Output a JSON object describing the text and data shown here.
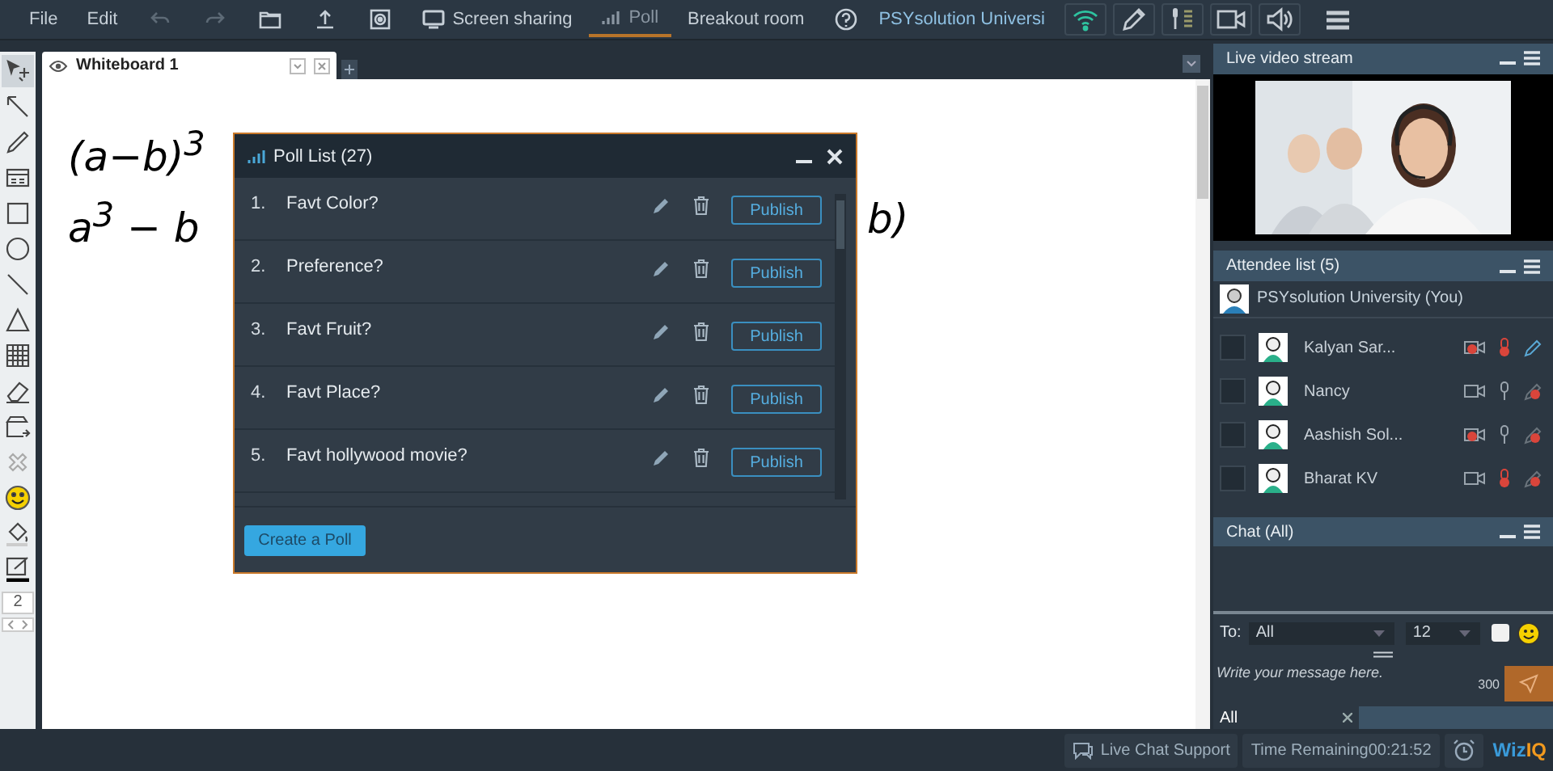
{
  "menu": {
    "items": [
      {
        "kind": "text",
        "label": "File",
        "selected": false,
        "disabled": false
      },
      {
        "kind": "text",
        "label": "Edit",
        "selected": false,
        "disabled": false
      },
      {
        "kind": "undo",
        "selected": false,
        "disabled": true
      },
      {
        "kind": "redo",
        "selected": false,
        "disabled": true
      },
      {
        "kind": "folder",
        "selected": false,
        "disabled": false
      },
      {
        "kind": "upload",
        "selected": false,
        "disabled": false
      },
      {
        "kind": "record",
        "selected": false,
        "disabled": false
      },
      {
        "kind": "screen",
        "label": "Screen sharing",
        "selected": false,
        "disabled": false
      },
      {
        "kind": "poll",
        "label": "Poll",
        "selected": true,
        "disabled": false
      },
      {
        "kind": "text",
        "label": "Breakout room",
        "selected": false,
        "disabled": false
      },
      {
        "kind": "help",
        "selected": false,
        "disabled": false
      }
    ],
    "user_name": "PSYsolution Universi",
    "controls": [
      {
        "kind": "wifi"
      },
      {
        "kind": "pen"
      },
      {
        "kind": "mic"
      },
      {
        "kind": "camera"
      },
      {
        "kind": "speaker"
      }
    ]
  },
  "whiteboard": {
    "tab": "Whiteboard 1",
    "tools": [
      {
        "kind": "select",
        "selected": true
      },
      {
        "kind": "arrow",
        "selected": false
      },
      {
        "kind": "pencil",
        "selected": false
      },
      {
        "kind": "textbox",
        "selected": false
      },
      {
        "kind": "rect",
        "selected": false
      },
      {
        "kind": "circle",
        "selected": false
      },
      {
        "kind": "line",
        "selected": false
      },
      {
        "kind": "triangle",
        "selected": false
      },
      {
        "kind": "table",
        "selected": false
      },
      {
        "kind": "eraser",
        "selected": false
      },
      {
        "kind": "move",
        "selected": false
      },
      {
        "kind": "clear",
        "selected": false
      },
      {
        "kind": "smiley",
        "selected": false
      },
      {
        "kind": "fill",
        "selected": false
      },
      {
        "kind": "stroke",
        "selected": false
      }
    ],
    "size": "2",
    "handwriting": [
      "(a−b)$^{3}$",
      "a$^{3}$ − b",
      "b)"
    ]
  },
  "poll": {
    "title": "Poll List (27)",
    "items": [
      {
        "number": "1.",
        "question": "Favt Color?",
        "action": "Publish"
      },
      {
        "number": "2.",
        "question": "Preference?",
        "action": "Publish"
      },
      {
        "number": "3.",
        "question": "Favt Fruit?",
        "action": "Publish"
      },
      {
        "number": "4.",
        "question": "Favt Place?",
        "action": "Publish"
      },
      {
        "number": "5.",
        "question": "Favt hollywood movie?",
        "action": "Publish"
      }
    ],
    "create_button": "Create a Poll"
  },
  "video": {
    "title": "Live video stream"
  },
  "attendees": {
    "title": "Attendee list (5)",
    "host": "PSYsolution University (You)",
    "rows": [
      {
        "name": "Kalyan Sar...",
        "checked": false,
        "camera_blocked": true,
        "mic_blocked": true,
        "pen_blocked": false
      },
      {
        "name": "Nancy",
        "checked": false,
        "camera_blocked": false,
        "mic_blocked": false,
        "pen_blocked": true
      },
      {
        "name": "Aashish Sol...",
        "checked": false,
        "camera_blocked": true,
        "mic_blocked": false,
        "pen_blocked": true
      },
      {
        "name": "Bharat KV",
        "checked": false,
        "camera_blocked": false,
        "mic_blocked": true,
        "pen_blocked": true
      }
    ]
  },
  "chat": {
    "title": "Chat (All)",
    "to_label": "To:",
    "recipient": "All",
    "font_size": "12",
    "placeholder": "Write your message here.",
    "char_count": "300",
    "tab": "All"
  },
  "footer": {
    "support": "Live Chat Support",
    "time": "Time Remaining00:21:52",
    "logo_1": "Wiz",
    "logo_2": "IQ"
  }
}
